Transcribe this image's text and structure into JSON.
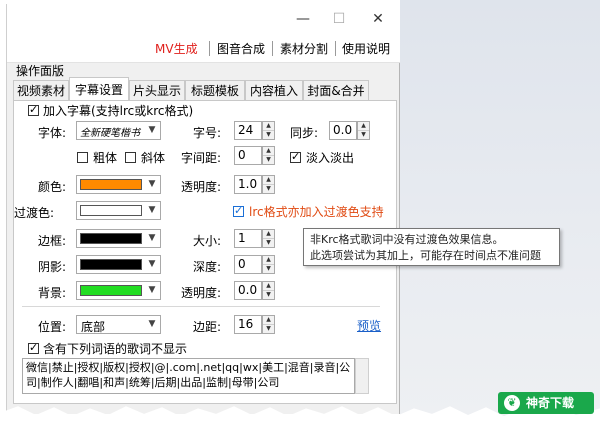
{
  "window": {
    "controls": {
      "minimize": "—",
      "maximize": "☐",
      "close": "✕"
    }
  },
  "menu": {
    "items": [
      "MV生成",
      "图音合成",
      "素材分割",
      "使用说明"
    ],
    "active_color": "#e0201c"
  },
  "section_label": "操作面版",
  "tabs": [
    "视频素材",
    "字幕设置",
    "片头显示",
    "标题模板",
    "内容植入",
    "封面&合并"
  ],
  "subtitle": {
    "enable_label": "加入字幕(支持lrc或krc格式)",
    "enable_checked": true,
    "font_label": "字体:",
    "font_value": "全新硬笔楷书",
    "bold_label": "粗体",
    "italic_label": "斜体",
    "size_label": "字号:",
    "size_value": "24",
    "sync_label": "同步:",
    "sync_value": "0.0",
    "spacing_label": "字间距:",
    "spacing_value": "0",
    "fade_label": "淡入淡出",
    "fade_checked": true,
    "color_label": "颜色:",
    "color_value": "#ff8a00",
    "opacity_label": "透明度:",
    "opacity_value": "1.0",
    "transition_label": "过渡色:",
    "transition_value": "#ffffff",
    "lrc_transition_label": "lrc格式亦加入过渡色支持",
    "lrc_transition_checked": true,
    "lrc_transition_color": "#e04a12",
    "border_label": "边框:",
    "border_value": "#000000",
    "border_size_label": "大小:",
    "border_size_value": "1",
    "shadow_label": "阴影:",
    "shadow_value": "#000000",
    "depth_label": "深度:",
    "depth_value": "0",
    "bg_label": "背景:",
    "bg_value": "#22dd22",
    "bg_opacity_label": "透明度:",
    "bg_opacity_value": "0.0",
    "position_label": "位置:",
    "position_value": "底部",
    "margin_label": "边距:",
    "margin_value": "16",
    "preview_link": "预览",
    "filter_label": "含有下列词语的歌词不显示",
    "filter_checked": true,
    "filter_text": "微信|禁止|授权|版权|授权|@|.com|.net|qq|wx|美工|混音|录音|公司|制作人|翻唱|和声|统筹|后期|出品|监制|母带|公司"
  },
  "tooltip": {
    "line1": "非Krc格式歌词中没有过渡色效果信息。",
    "line2": "此选项尝试为其加上，可能存在时间点不准问题"
  },
  "watermark": "神奇下载"
}
